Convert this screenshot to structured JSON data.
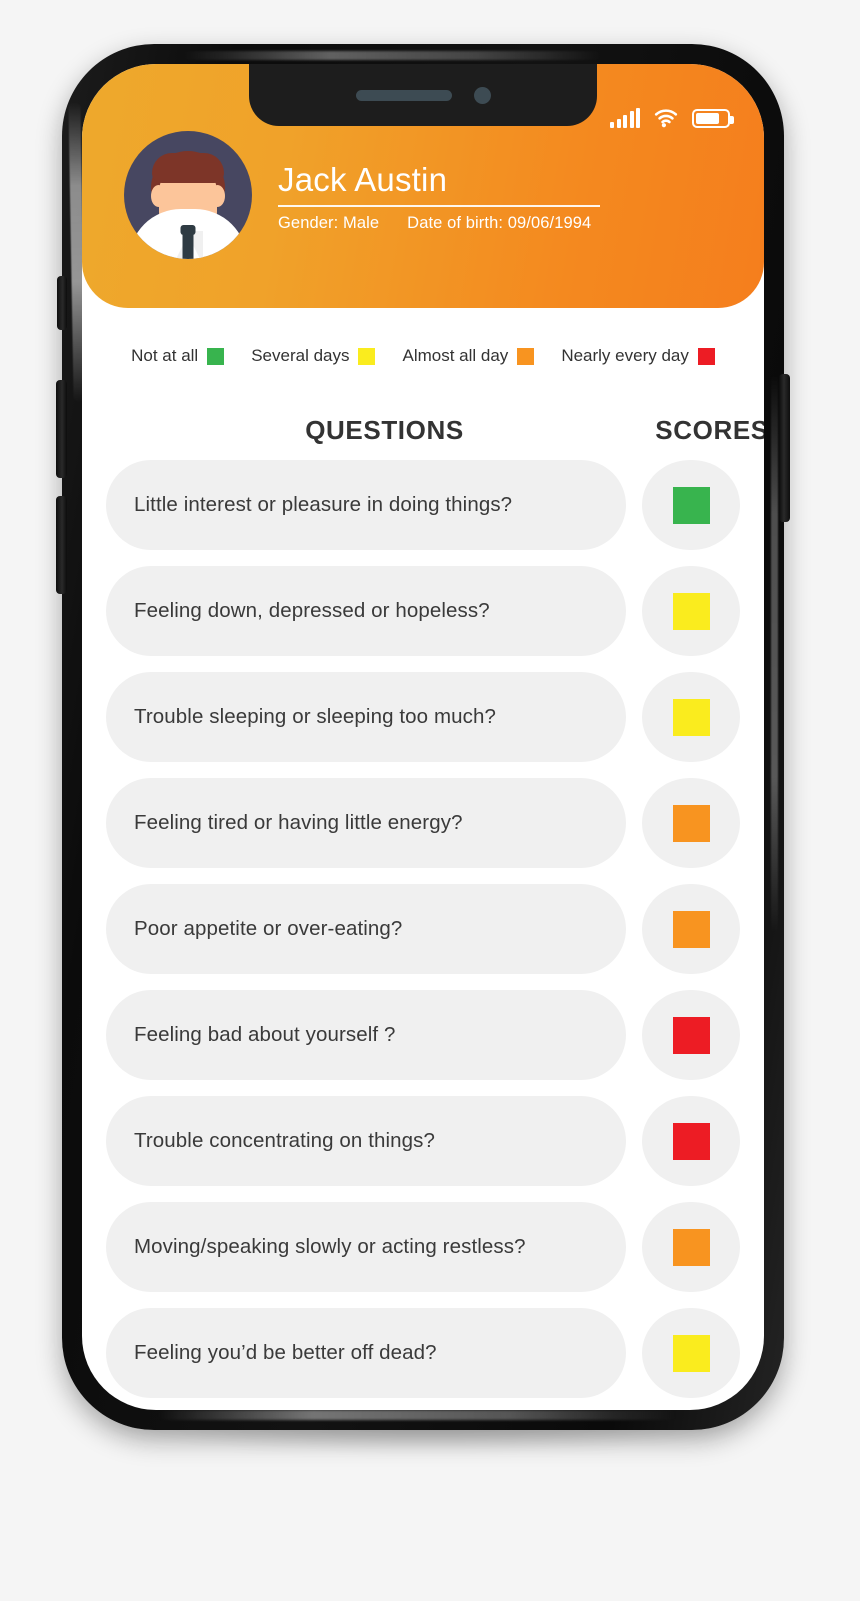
{
  "app": {
    "background_color": "#f5f5f5"
  },
  "status_bar": {
    "signal_icon": "cellular-signal-icon",
    "wifi_icon": "wifi-icon",
    "battery_icon": "battery-icon",
    "battery_level_percent": 68
  },
  "notch": {
    "speaker_icon": "speaker-grille-icon",
    "camera_icon": "front-camera-icon"
  },
  "header": {
    "gradient_start": "#eea92c",
    "gradient_end": "#f57e1d",
    "avatar_icon": "user-avatar-icon",
    "name": "Jack Austin",
    "gender": "Gender: Male",
    "date_of_birth": "Date of birth: 09/06/1994"
  },
  "legend": {
    "items": [
      {
        "label": "Not at all",
        "color": "#38b44e"
      },
      {
        "label": "Several days",
        "color": "#faec1e"
      },
      {
        "label": "Almost all day",
        "color": "#f89420"
      },
      {
        "label": "Nearly every day",
        "color": "#ed1c24"
      }
    ]
  },
  "columns": {
    "questions_heading": "QUESTIONS",
    "scores_heading": "SCORES"
  },
  "questionnaire": {
    "rows": [
      {
        "question": "Little interest or pleasure in doing things?",
        "score_color": "#38b44e",
        "score_label": "Not at all"
      },
      {
        "question": "Feeling down, depressed or hopeless?",
        "score_color": "#faec1e",
        "score_label": "Several days"
      },
      {
        "question": "Trouble sleeping or sleeping too much?",
        "score_color": "#faec1e",
        "score_label": "Several days"
      },
      {
        "question": "Feeling tired or having little energy?",
        "score_color": "#f89420",
        "score_label": "Almost all day"
      },
      {
        "question": "Poor appetite or over-eating?",
        "score_color": "#f89420",
        "score_label": "Almost all day"
      },
      {
        "question": "Feeling bad about yourself ?",
        "score_color": "#ed1c24",
        "score_label": "Nearly every day"
      },
      {
        "question": "Trouble concentrating on things?",
        "score_color": "#ed1c24",
        "score_label": "Nearly every day"
      },
      {
        "question": "Moving/speaking slowly or acting restless?",
        "score_color": "#f89420",
        "score_label": "Almost all day"
      },
      {
        "question": "Feeling you’d be better off dead?",
        "score_color": "#faec1e",
        "score_label": "Several days"
      }
    ]
  }
}
